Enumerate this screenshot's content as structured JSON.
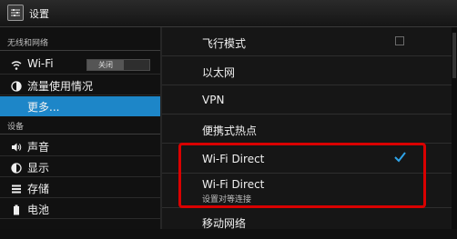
{
  "title": "设置",
  "sidebar": {
    "sections": [
      {
        "header": "无线和网络"
      },
      {
        "header": "设备"
      }
    ],
    "items": [
      {
        "label": "Wi-Fi",
        "icon": "wifi-icon"
      },
      {
        "label": "流量使用情况",
        "icon": "data-usage-icon"
      },
      {
        "label": "更多...",
        "icon": ""
      },
      {
        "label": "声音",
        "icon": "volume-icon"
      },
      {
        "label": "显示",
        "icon": "brightness-icon"
      },
      {
        "label": "存储",
        "icon": "storage-icon"
      },
      {
        "label": "电池",
        "icon": "battery-icon"
      }
    ],
    "wifi_toggle": "关闭"
  },
  "main": {
    "rows": [
      {
        "label": "飞行模式",
        "control": "checkbox",
        "checked": false
      },
      {
        "label": "以太网"
      },
      {
        "label": "VPN"
      },
      {
        "label": "便携式热点"
      },
      {
        "label": "Wi-Fi Direct",
        "control": "checkbox",
        "checked": true
      },
      {
        "label": "Wi-Fi Direct",
        "sub": "设置对等连接"
      },
      {
        "label": "移动网络"
      }
    ]
  },
  "colors": {
    "selected": "#1d86c8",
    "highlight_box": "#d90000",
    "check": "#2fa3e8"
  }
}
